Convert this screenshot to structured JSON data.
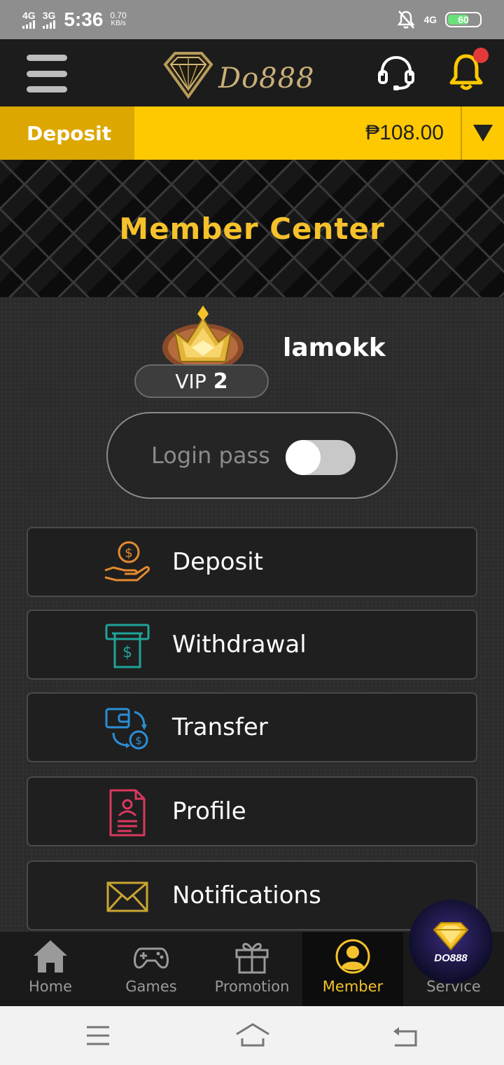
{
  "status_bar": {
    "net1": "4G",
    "net2": "3G",
    "time": "5:36",
    "speed_value": "0.70",
    "speed_unit": "KB/s",
    "net3": "4G",
    "battery": "60"
  },
  "header": {
    "logo_text": "Do888"
  },
  "wallet": {
    "deposit_label": "Deposit",
    "balance": "₱108.00"
  },
  "banner": {
    "title": "Member Center"
  },
  "member": {
    "vip_prefix": "VIP",
    "vip_level": "2",
    "username": "lamokk",
    "login_pass_label": "Login pass",
    "login_pass_enabled": false
  },
  "menu": {
    "deposit": "Deposit",
    "withdrawal": "Withdrawal",
    "transfer": "Transfer",
    "profile": "Profile",
    "notifications": "Notifications"
  },
  "bottom_nav": {
    "home": "Home",
    "games": "Games",
    "promotion": "Promotion",
    "member": "Member",
    "service": "Service",
    "active": "Member"
  },
  "float_logo": {
    "text": "DO888"
  },
  "colors": {
    "accent_yellow": "#ffc902",
    "accent_gold": "#f5c22b",
    "deposit_icon": "#e58a2e",
    "withdraw_icon": "#1fa39a",
    "transfer_icon": "#2a8fd6",
    "profile_icon": "#d9385e",
    "notifications_icon": "#c9a531"
  },
  "icons": {
    "menu": "hamburger-icon",
    "support": "headset-icon",
    "bell": "bell-icon",
    "dropdown": "caret-down-icon"
  }
}
